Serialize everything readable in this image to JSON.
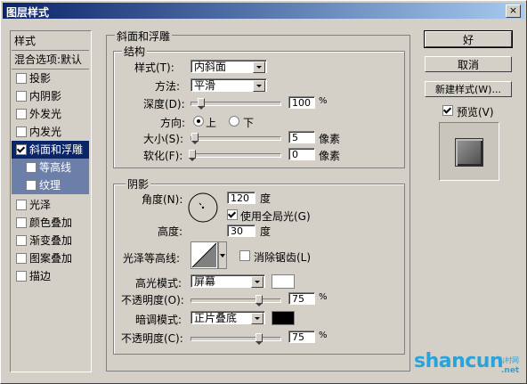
{
  "window": {
    "title": "图层样式",
    "close": "×"
  },
  "sidebar": {
    "items": [
      {
        "label": "样式",
        "type": "header"
      },
      {
        "label": "混合选项:默认",
        "type": "header"
      },
      {
        "label": "投影",
        "checked": false
      },
      {
        "label": "内阴影",
        "checked": false
      },
      {
        "label": "外发光",
        "checked": false
      },
      {
        "label": "内发光",
        "checked": false
      },
      {
        "label": "斜面和浮雕",
        "checked": true,
        "selected": true
      },
      {
        "label": "等高线",
        "checked": false,
        "sub": true
      },
      {
        "label": "纹理",
        "checked": false,
        "sub": true
      },
      {
        "label": "光泽",
        "checked": false
      },
      {
        "label": "颜色叠加",
        "checked": false
      },
      {
        "label": "渐变叠加",
        "checked": false
      },
      {
        "label": "图案叠加",
        "checked": false
      },
      {
        "label": "描边",
        "checked": false
      }
    ]
  },
  "panel": {
    "title": "斜面和浮雕",
    "structure": {
      "title": "结构",
      "style_label": "样式(T):",
      "style_value": "内斜面",
      "method_label": "方法:",
      "method_value": "平滑",
      "depth_label": "深度(D):",
      "depth_value": "100",
      "depth_unit": "%",
      "depth_pct": 0.1,
      "direction_label": "方向:",
      "dir_up": "上",
      "dir_down": "下",
      "size_label": "大小(S):",
      "size_value": "5",
      "size_unit": "像素",
      "size_pct": 0.03,
      "soften_label": "软化(F):",
      "soften_value": "0",
      "soften_unit": "像素",
      "soften_pct": 0.0
    },
    "shading": {
      "title": "阴影",
      "angle_label": "角度(N):",
      "angle_value": "120",
      "angle_unit": "度",
      "global_light_label": "使用全局光(G)",
      "altitude_label": "高度:",
      "altitude_value": "30",
      "altitude_unit": "度",
      "gloss_label": "光泽等高线:",
      "anti_alias_label": "消除锯齿(L)",
      "highlight_mode_label": "高光模式:",
      "highlight_mode_value": "屏幕",
      "highlight_color": "#ffffff",
      "highlight_opacity_label": "不透明度(O):",
      "highlight_opacity_value": "75",
      "highlight_opacity_unit": "%",
      "highlight_opacity_pct": 0.75,
      "shadow_mode_label": "暗调模式:",
      "shadow_mode_value": "正片叠底",
      "shadow_color": "#000000",
      "shadow_opacity_label": "不透明度(C):",
      "shadow_opacity_value": "75",
      "shadow_opacity_unit": "%",
      "shadow_opacity_pct": 0.75
    }
  },
  "buttons": {
    "ok": "好",
    "cancel": "取消",
    "new_style": "新建样式(W)...",
    "preview": "预览(V)"
  },
  "watermark": {
    "text": "shancun",
    "sub": "山村网",
    "domain": ".net"
  }
}
